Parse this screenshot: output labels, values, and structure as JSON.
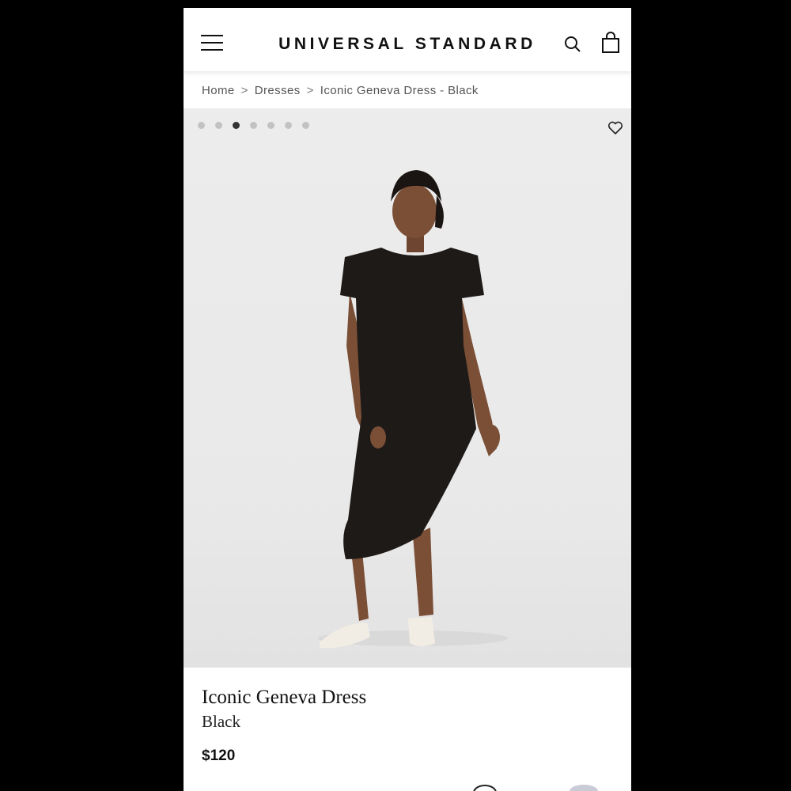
{
  "header": {
    "brand": "UNIVERSAL STANDARD",
    "menu_icon": "hamburger-menu-icon",
    "search_icon": "search-icon",
    "bag_icon": "shopping-bag-icon"
  },
  "breadcrumb": {
    "items": [
      "Home",
      "Dresses",
      "Iconic Geneva Dress - Black"
    ],
    "separator": ">"
  },
  "gallery": {
    "image_count": 7,
    "active_index": 3,
    "favorite_icon": "heart-icon"
  },
  "product": {
    "name": "Iconic Geneva Dress",
    "color": "Black",
    "price": "$120"
  },
  "colors": {
    "page_bg": "#000000",
    "hero_bg": "#ebebeb",
    "dress": "#1e1a18",
    "text": "#111111"
  }
}
